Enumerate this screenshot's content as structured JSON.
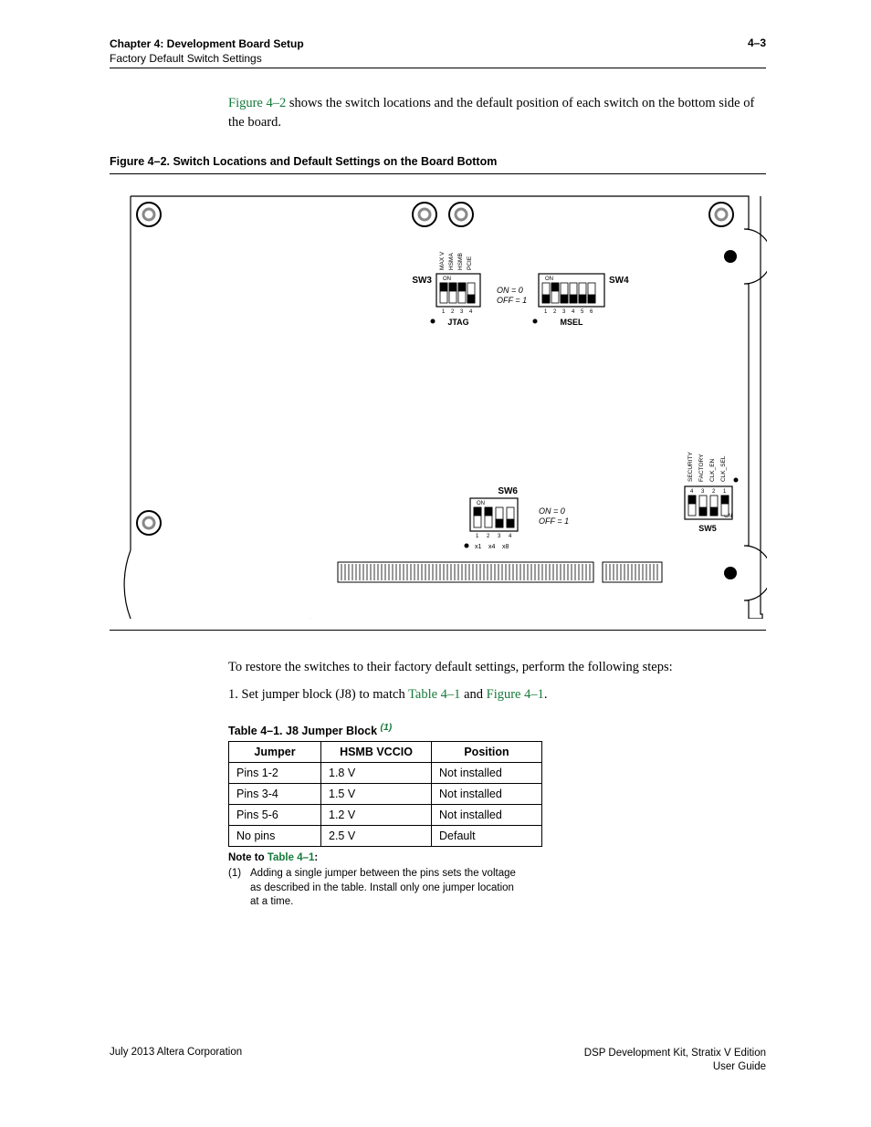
{
  "header": {
    "chapter": "Chapter 4:  Development Board Setup",
    "section": "Factory Default Switch Settings",
    "page": "4–3"
  },
  "intro": {
    "ref": "Figure 4–2",
    "rest": " shows the switch locations and the default position of each switch on the bottom side of the board."
  },
  "figure": {
    "caption": "Figure 4–2.  Switch Locations and Default Settings on the Board Bottom",
    "sw3": {
      "label": "SW3",
      "name": "JTAG",
      "pinLabels": [
        "MAX V",
        "HSMA",
        "HSMB",
        "PCIE"
      ],
      "positions": [
        "1",
        "2",
        "3",
        "4"
      ],
      "on": "ON"
    },
    "sw4": {
      "label": "SW4",
      "name": "MSEL",
      "positions": [
        "1",
        "2",
        "3",
        "4",
        "5",
        "6"
      ],
      "on": "ON"
    },
    "legend34": {
      "on": "ON = 0",
      "off": "OFF = 1"
    },
    "sw5": {
      "label": "SW5",
      "pinLabels": [
        "SECURITY",
        "FACTORY",
        "CLK_EN",
        "CLK_SEL"
      ],
      "positions": [
        "4",
        "3",
        "2",
        "1"
      ],
      "on": "ON"
    },
    "sw6": {
      "label": "SW6",
      "positions": [
        "1",
        "2",
        "3",
        "4"
      ],
      "bottomLabels": [
        "x1",
        "x4",
        "x8"
      ],
      "on": "ON"
    },
    "legend56": {
      "on": "ON = 0",
      "off": "OFF = 1"
    }
  },
  "restore": "To restore the switches to their factory default settings, perform the following steps:",
  "step1": {
    "pre": "1.   Set jumper block (J8) to match ",
    "ref1": "Table 4–1",
    "mid": " and ",
    "ref2": "Figure 4–1",
    "post": "."
  },
  "table": {
    "caption": "Table 4–1.  J8 Jumper Block ",
    "note_mark": "(1)",
    "headers": [
      "Jumper",
      "HSMB VCCIO",
      "Position"
    ],
    "rows": [
      [
        "Pins 1-2",
        "1.8 V",
        "Not installed"
      ],
      [
        "Pins 3-4",
        "1.5 V",
        "Not installed"
      ],
      [
        "Pins 5-6",
        "1.2 V",
        "Not installed"
      ],
      [
        "No pins",
        "2.5 V",
        "Default"
      ]
    ],
    "noteTo_pre": "Note to ",
    "noteTo_ref": "Table 4–1",
    "noteTo_post": ":",
    "noteNum": "(1)",
    "noteText": "Adding a single jumper between the pins sets the voltage as described in the table. Install only one jumper location at a time."
  },
  "footer": {
    "left": "July 2013    Altera Corporation",
    "right1": "DSP Development Kit, Stratix V Edition",
    "right2": "User Guide"
  }
}
